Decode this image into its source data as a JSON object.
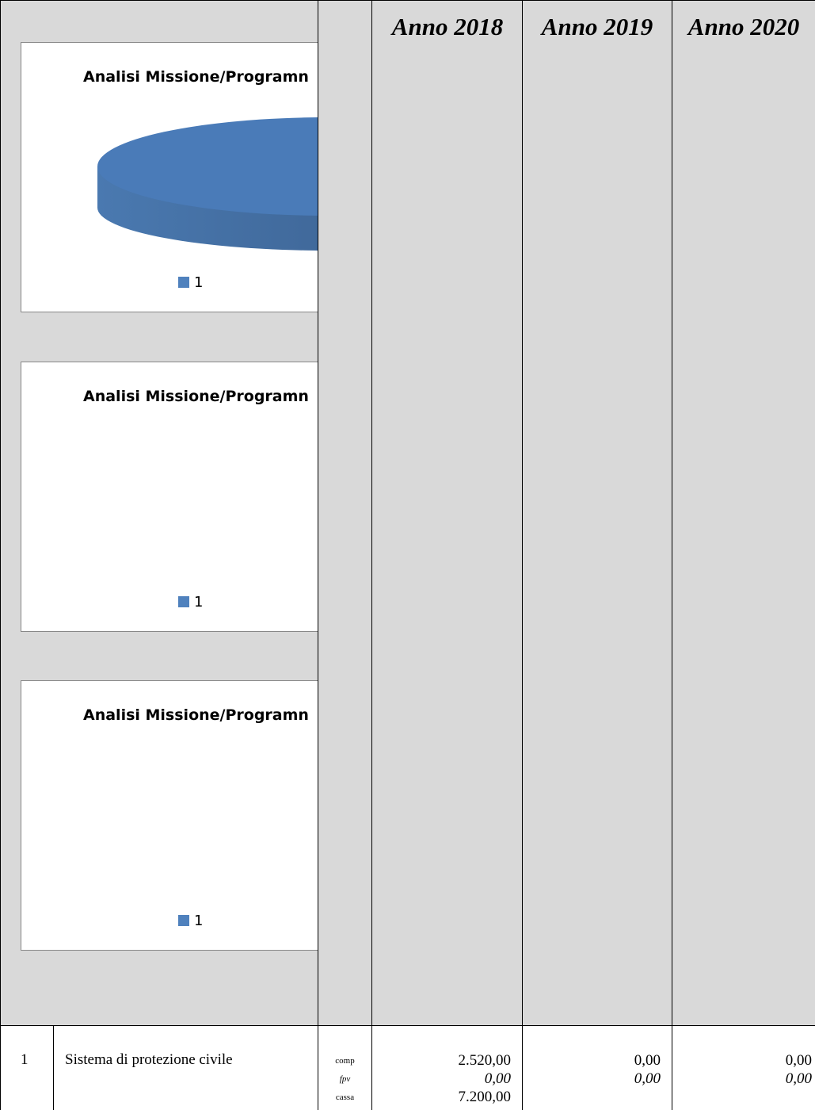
{
  "header": {
    "years": [
      "Anno 2018",
      "Anno 2019",
      "Anno 2020"
    ]
  },
  "charts": [
    {
      "title": "Analisi Missione/Programn",
      "legend": "1",
      "has_pie": true
    },
    {
      "title": "Analisi Missione/Programn",
      "legend": "1",
      "has_pie": false
    },
    {
      "title": "Analisi Missione/Programn",
      "legend": "1",
      "has_pie": false
    }
  ],
  "colors": {
    "grey_bg": "#d9d9d9",
    "pie_blue": "#4f81bd"
  },
  "row": {
    "number": "1",
    "description": "Sistema di protezione civile",
    "labels": {
      "comp": "comp",
      "fpv": "fpv",
      "cassa": "cassa"
    },
    "y2018": {
      "comp": "2.520,00",
      "fpv": "0,00",
      "cassa": "7.200,00"
    },
    "y2019": {
      "comp": "0,00",
      "fpv": "0,00"
    },
    "y2020": {
      "comp": "0,00",
      "fpv": "0,00"
    }
  }
}
